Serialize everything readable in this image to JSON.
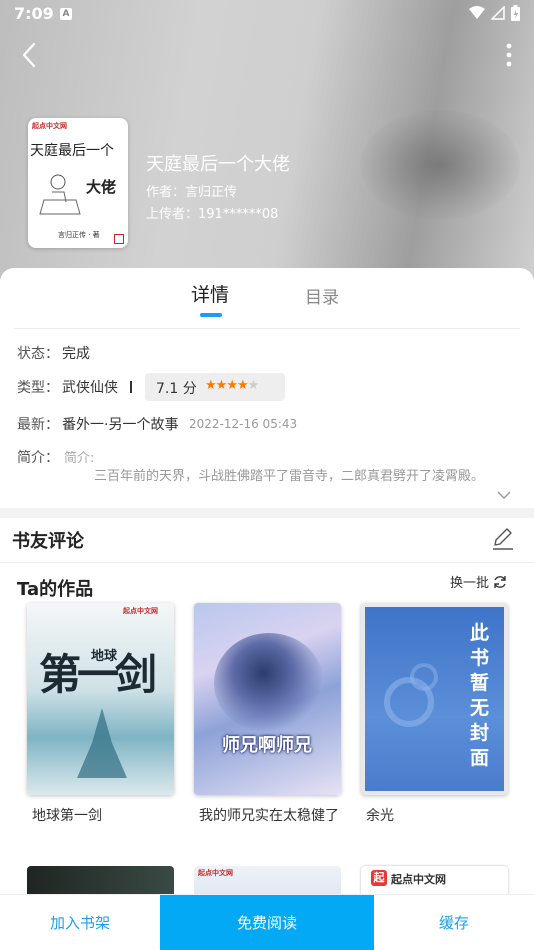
{
  "status_bar": {
    "time": "7:09",
    "notification_letter": "A"
  },
  "book": {
    "cover": {
      "brand": "起点中文网",
      "title_line1": "天庭最后一个",
      "title_line2": "大佬",
      "author": "言归正传 · 著"
    },
    "title": "天庭最后一个大佬",
    "author": "作者：言归正传",
    "uploader": "上传者：191******08"
  },
  "tabs": {
    "detail": "详情",
    "toc": "目录"
  },
  "details": {
    "status_label": "状态：",
    "status_value": "完成",
    "type_label": "类型：",
    "type_value": "武侠仙侠",
    "score": "7.1 分",
    "rating_fraction": 0.71,
    "latest_label": "最新：",
    "latest_value": "番外一·另一个故事",
    "latest_time": "2022-12-16 05:43",
    "intro_label": "简介：",
    "intro_head": "简介:",
    "intro_text": "三百年前的天界，斗战胜佛踏平了雷音寺，二郎真君劈开了凌霄殿。"
  },
  "comments": {
    "title": "书友评论"
  },
  "works": {
    "title": "Ta的作品",
    "refresh_label": "换一批",
    "items": [
      {
        "name": "地球第一剑",
        "cover_big": "第一剑",
        "cover_small": "地球",
        "cover_brand": "起点中文网"
      },
      {
        "name": "我的师兄实在太稳健了",
        "cover_title": "师兄啊师兄"
      },
      {
        "name": "余光",
        "cover_vertical": "此书暂无封面"
      }
    ],
    "next_row_logo": "起点中文网",
    "next_row_brand_small": "起点中文网"
  },
  "bottom_bar": {
    "shelf": "加入书架",
    "read": "免费阅读",
    "cache": "缓存"
  },
  "colors": {
    "accent": "#1a9ff0",
    "read_button": "#03a9f4",
    "star": "#ff7a00"
  }
}
